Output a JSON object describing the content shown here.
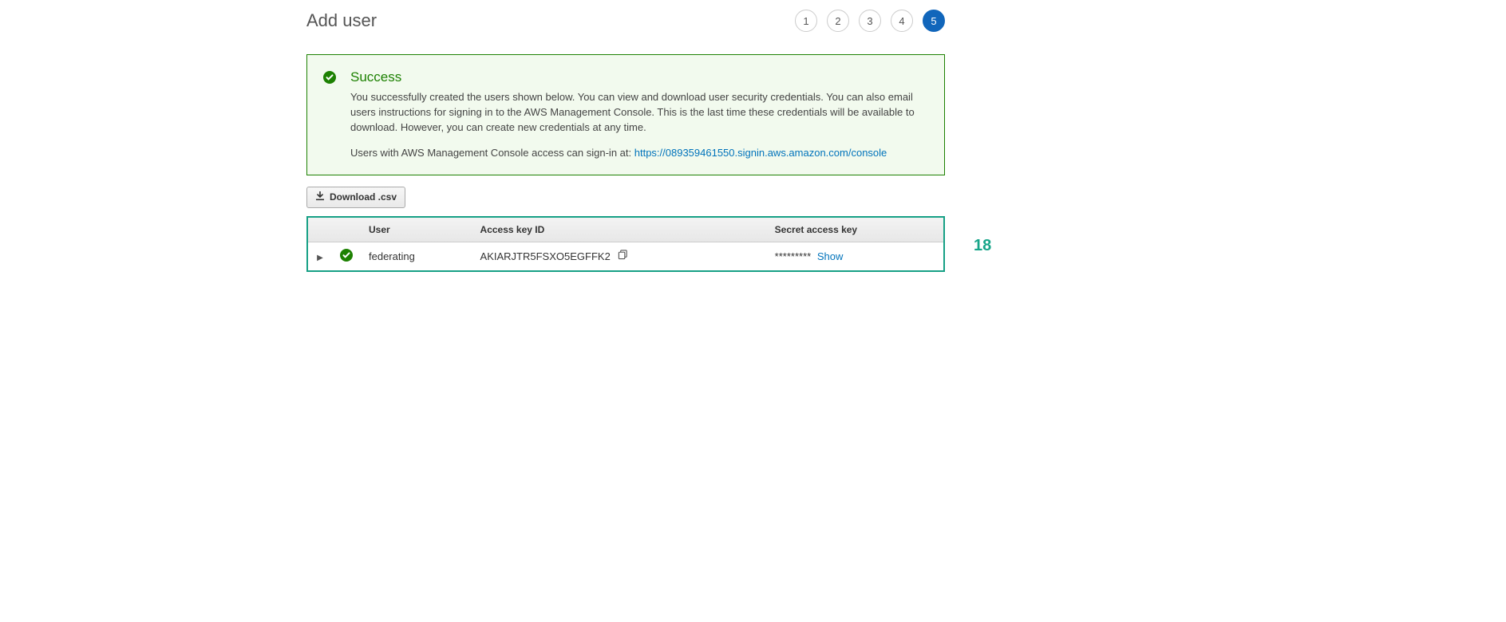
{
  "page_title": "Add user",
  "steps": [
    "1",
    "2",
    "3",
    "4",
    "5"
  ],
  "active_step": 5,
  "success": {
    "title": "Success",
    "body": "You successfully created the users shown below. You can view and download user security credentials. You can also email users instructions for signing in to the AWS Management Console. This is the last time these credentials will be available to download. However, you can create new credentials at any time.",
    "signin_prefix": "Users with AWS Management Console access can sign-in at: ",
    "signin_url": "https://089359461550.signin.aws.amazon.com/console"
  },
  "download_label": "Download .csv",
  "table": {
    "headers": {
      "user": "User",
      "access_key": "Access key ID",
      "secret": "Secret access key"
    },
    "rows": [
      {
        "user": "federating",
        "access_key_id": "AKIARJTR5FSXO5EGFFK2",
        "secret_mask": "*********",
        "show_label": "Show"
      }
    ]
  },
  "annotation": "18"
}
